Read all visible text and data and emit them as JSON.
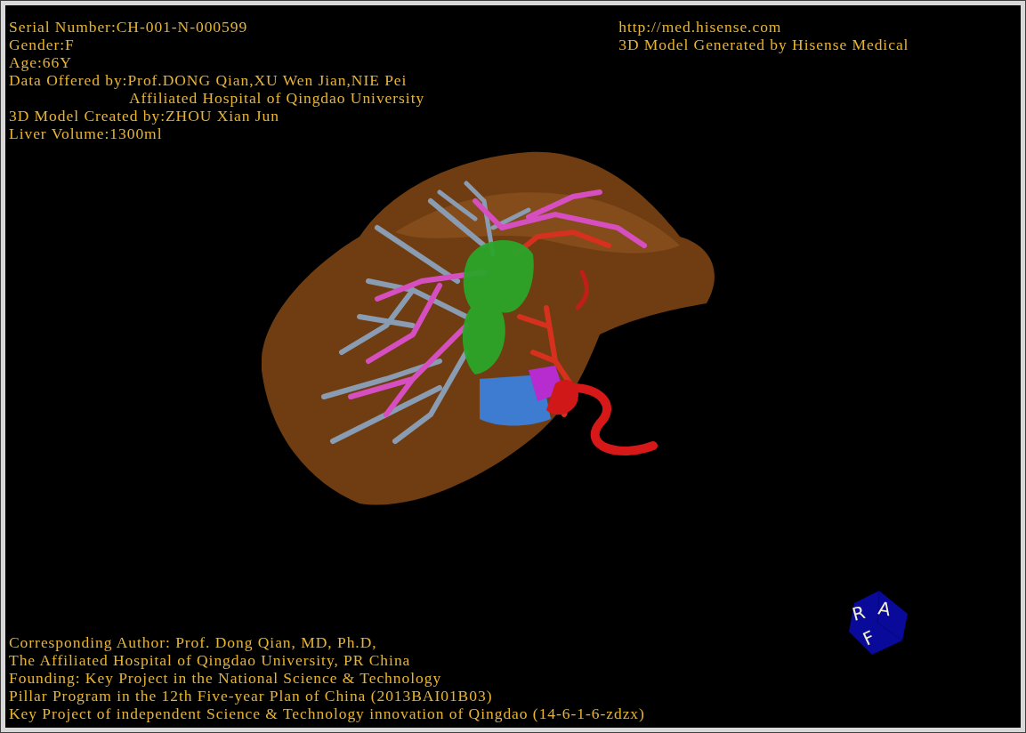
{
  "case_info": [
    {
      "text": "Serial Number:CH-001-N-000599"
    },
    {
      "text": "Gender:F"
    },
    {
      "text": "Age:66Y"
    },
    {
      "text": "Data Offered by:Prof.DONG Qian,XU Wen Jian,NIE Pei",
      "continuation": "Affiliated Hospital of Qingdao University"
    },
    {
      "text": "3D Model Created by:ZHOU Xian Jun"
    },
    {
      "text": "Liver Volume:1300ml"
    }
  ],
  "credits": [
    "http://med.hisense.com",
    "3D Model Generated by Hisense Medical"
  ],
  "footer": [
    "Corresponding Author: Prof. Dong Qian, MD, Ph.D,",
    "The Affiliated Hospital of Qingdao University, PR China",
    "Founding: Key Project in the National Science & Technology",
    "Pillar Program in the 12th Five-year Plan of China (2013BAI01B03)",
    "Key Project of independent Science & Technology innovation of Qingdao (14-6-1-6-zdzx)"
  ],
  "orientation_cube": {
    "labels": [
      "R",
      "A",
      "F"
    ]
  }
}
